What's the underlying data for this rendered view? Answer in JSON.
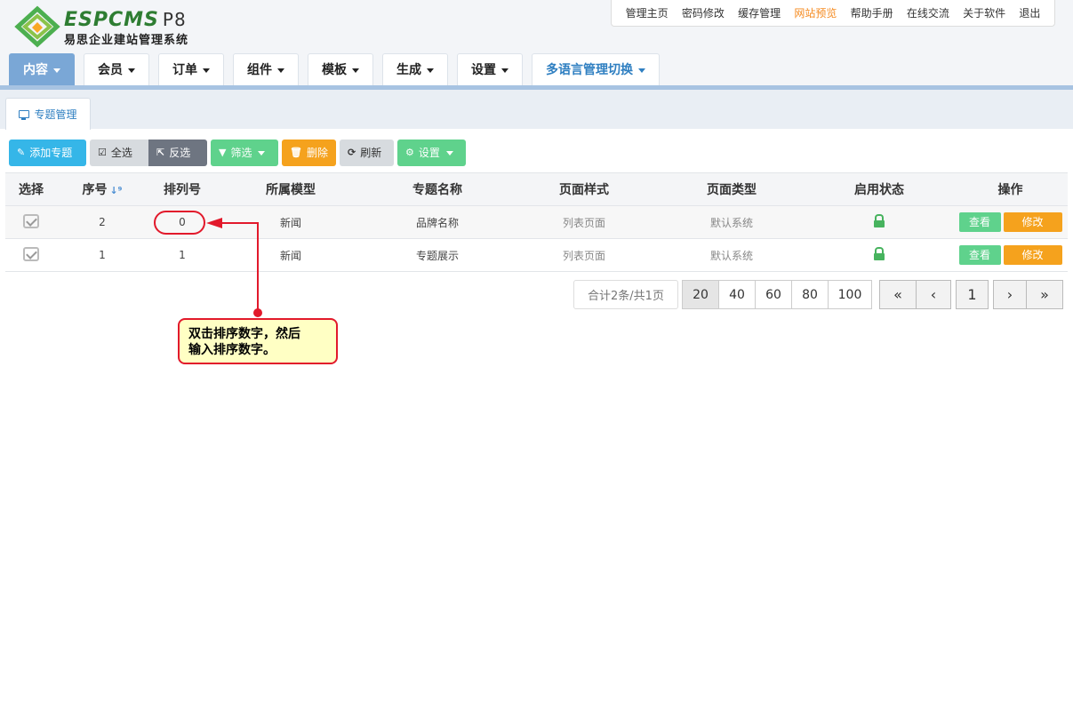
{
  "brand": {
    "name": "ESPCMS",
    "version": "P8",
    "subtitle": "易思企业建站管理系统"
  },
  "top_links": [
    {
      "label": "管理主页"
    },
    {
      "label": "密码修改"
    },
    {
      "label": "缓存管理"
    },
    {
      "label": "网站预览",
      "accent": "#f58a1f"
    },
    {
      "label": "帮助手册"
    },
    {
      "label": "在线交流"
    },
    {
      "label": "关于软件"
    },
    {
      "label": "退出"
    }
  ],
  "main_nav": [
    {
      "label": "内容",
      "active": true
    },
    {
      "label": "会员"
    },
    {
      "label": "订单"
    },
    {
      "label": "组件"
    },
    {
      "label": "模板"
    },
    {
      "label": "生成"
    },
    {
      "label": "设置"
    },
    {
      "label": "多语言管理切换"
    }
  ],
  "sub_tab": {
    "label": "专题管理"
  },
  "toolbar": {
    "add": "添加专题",
    "select_all": "全选",
    "invert": "反选",
    "filter": "筛选",
    "delete": "删除",
    "refresh": "刷新",
    "settings": "设置"
  },
  "table": {
    "headers": [
      "选择",
      "序号",
      "排列号",
      "所属模型",
      "专题名称",
      "页面样式",
      "页面类型",
      "启用状态",
      "操作"
    ],
    "rows": [
      {
        "id": "2",
        "order": "0",
        "model": "新闻",
        "name": "品牌名称",
        "style": "列表页面",
        "type": "默认系统",
        "status": "unlocked"
      },
      {
        "id": "1",
        "order": "1",
        "model": "新闻",
        "name": "专题展示",
        "style": "列表页面",
        "type": "默认系统",
        "status": "unlocked"
      }
    ],
    "action_view": "查看",
    "action_edit": "修改"
  },
  "pagination": {
    "info": "合计2条/共1页",
    "sizes": [
      "20",
      "40",
      "60",
      "80",
      "100"
    ],
    "current_size": "20",
    "first": "«",
    "prev": "‹",
    "page": "1",
    "next": "›",
    "last": "»"
  },
  "annotation": {
    "line1": "双击排序数字，然后",
    "line2": "输入排序数字。"
  },
  "colors": {
    "accent_blue": "#7aa7d6",
    "green": "#5fd28c",
    "orange": "#f5a21d",
    "annotation_red": "#e2192b"
  }
}
